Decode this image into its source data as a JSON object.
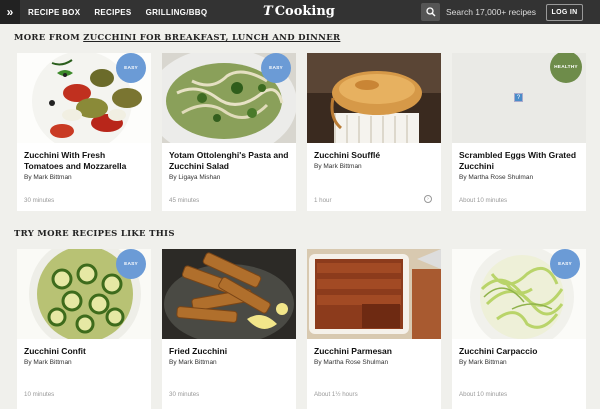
{
  "topbar": {
    "expand_glyph": "»",
    "nav": [
      "RECIPE BOX",
      "RECIPES",
      "GRILLING/BBQ"
    ],
    "logo_t": "T",
    "logo_text": "Cooking",
    "search_placeholder": "Search 17,000+ recipes",
    "login": "LOG IN"
  },
  "section1": {
    "prefix": "MORE FROM ",
    "link": "ZUCCHINI FOR BREAKFAST, LUNCH AND DINNER"
  },
  "section2": {
    "title": "TRY MORE RECIPES LIKE THIS"
  },
  "cards1": [
    {
      "title": "Zucchini With Fresh Tomatoes and Mozzarella",
      "author": "By Mark Bittman",
      "time": "30 minutes",
      "badge": "EASY"
    },
    {
      "title": "Yotam Ottolenghi's Pasta and Zucchini Salad",
      "author": "By Ligaya Mishan",
      "time": "45 minutes",
      "badge": "EASY"
    },
    {
      "title": "Zucchini Soufflé",
      "author": "By Mark Bittman",
      "time": "1 hour",
      "badge": ""
    },
    {
      "title": "Scrambled Eggs With Grated Zucchini",
      "author": "By Martha Rose Shulman",
      "time": "About 10 minutes",
      "badge": "HEALTHY"
    }
  ],
  "cards2": [
    {
      "title": "Zucchini Confit",
      "author": "By Mark Bittman",
      "time": "10 minutes",
      "badge": "EASY"
    },
    {
      "title": "Fried Zucchini",
      "author": "By Mark Bittman",
      "time": "30 minutes",
      "badge": ""
    },
    {
      "title": "Zucchini Parmesan",
      "author": "By Martha Rose Shulman",
      "time": "About 1½ hours",
      "badge": ""
    },
    {
      "title": "Zucchini Carpaccio",
      "author": "By Mark Bittman",
      "time": "About 10 minutes",
      "badge": "EASY"
    }
  ],
  "colors": {
    "easy_badge": "#6b9bd6",
    "healthy_badge": "#6e8c4a",
    "topbar": "#333333"
  },
  "icons": {
    "search": "search-icon",
    "save": "save-icon",
    "broken_image": "broken-image-icon"
  }
}
